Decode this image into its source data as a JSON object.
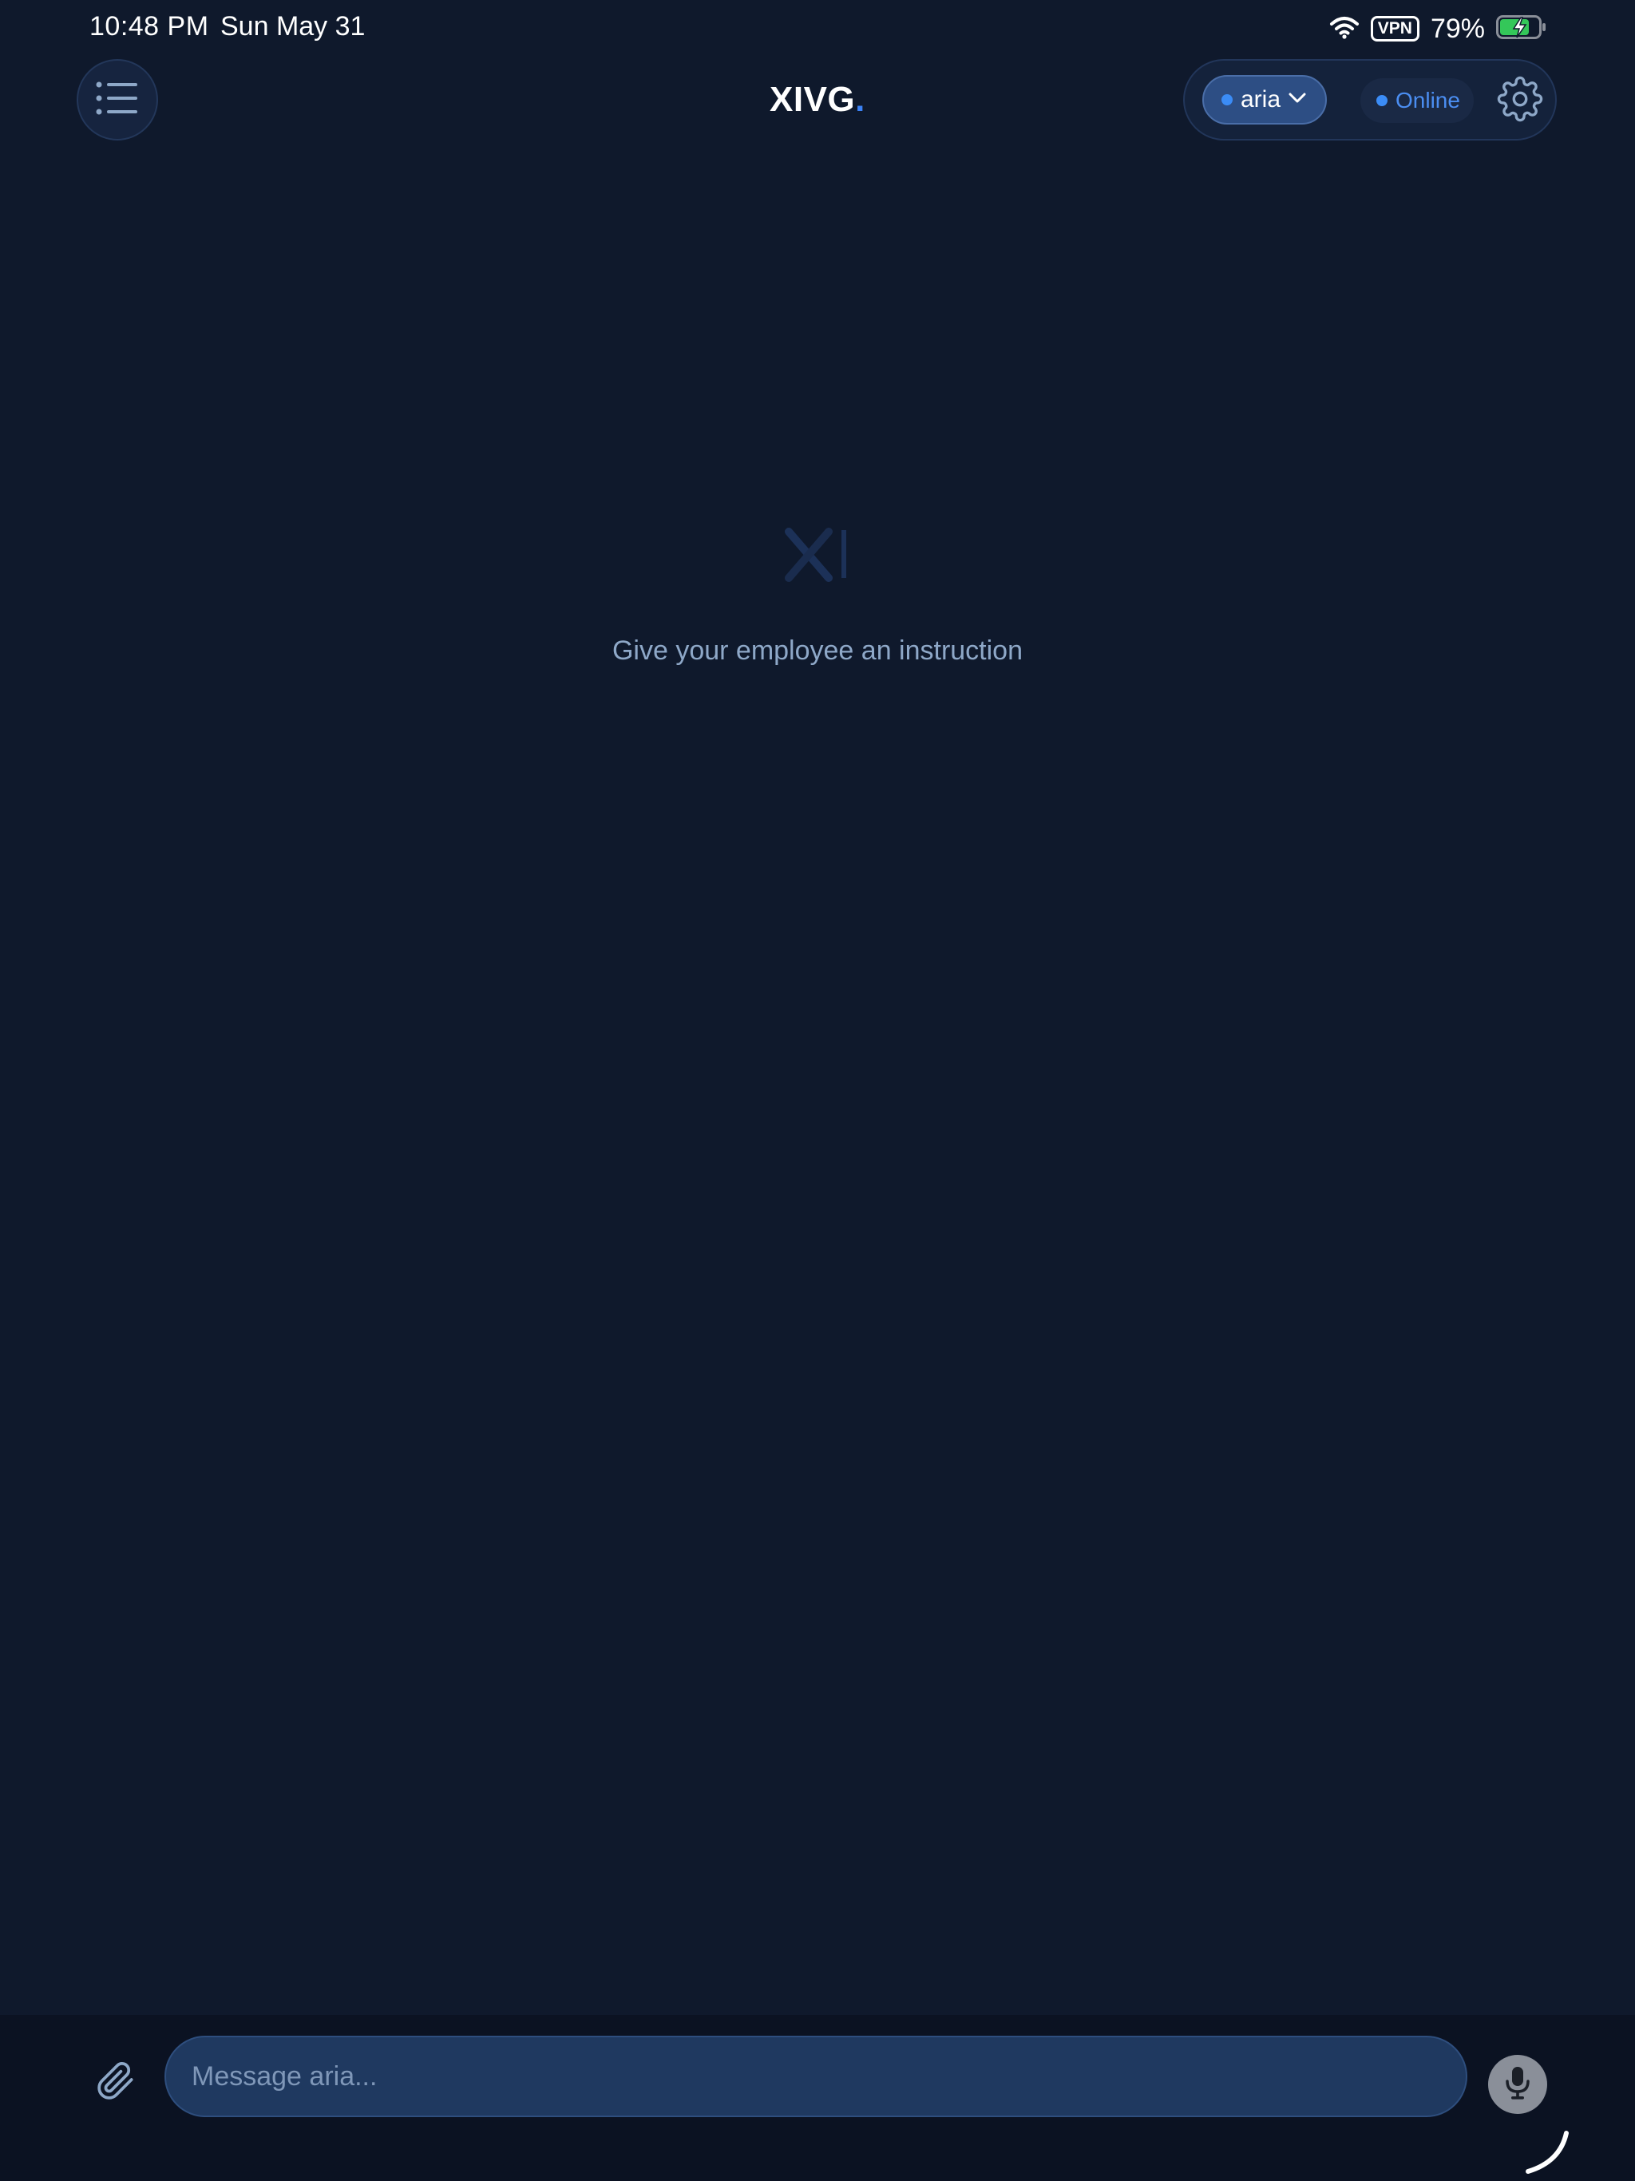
{
  "status_bar": {
    "time": "10:48 PM",
    "date": "Sun May 31",
    "vpn": "VPN",
    "battery": "79%"
  },
  "header": {
    "title": "XIVG",
    "title_dot": ".",
    "agent": {
      "label": "aria",
      "icon": "chevron-down-icon"
    },
    "status": {
      "label": "Online"
    },
    "menu_icon": "list-icon",
    "settings_icon": "gear-icon"
  },
  "empty_state": {
    "logo": "XI",
    "text": "Give your employee an instruction"
  },
  "composer": {
    "placeholder": "Message aria...",
    "value": "",
    "attach_icon": "paperclip-icon",
    "mic_icon": "microphone-icon"
  },
  "colors": {
    "background": "#0f192c",
    "accent": "#3b82f6",
    "online": "#4b8ef2",
    "input_bg": "#1f3960"
  }
}
